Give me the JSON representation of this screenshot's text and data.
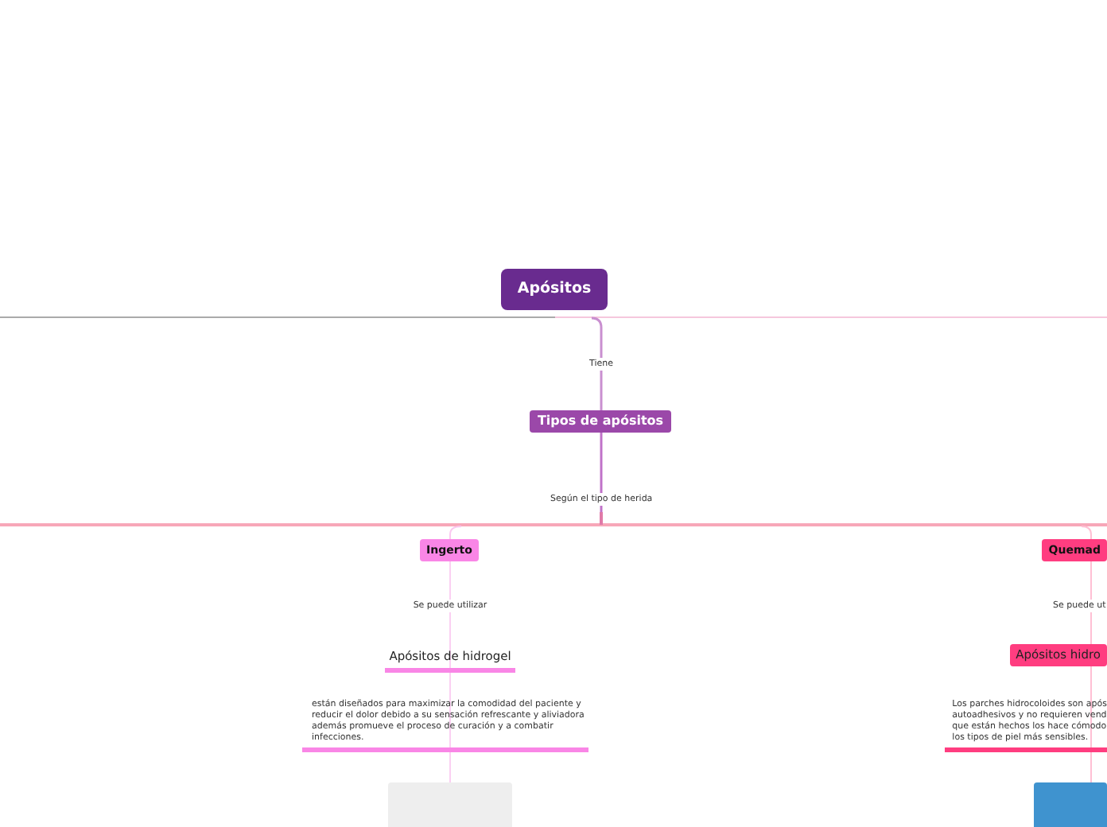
{
  "root": {
    "label": "Apósitos"
  },
  "root_link": "Tiene",
  "main_topic": {
    "label": "Tipos de apósitos"
  },
  "main_link": "Según el tipo de herida",
  "branches": [
    {
      "label": "Ingerto",
      "color": "#f986e6",
      "link": "Se puede utilizar",
      "subtopic": {
        "label": "Apósitos de hidrogel",
        "kind": "underlined"
      },
      "description": [
        "están diseñados para maximizar la comodidad del paciente y",
        "reducir el dolor  debido a su sensación refrescante y aliviadora",
        "además promueve el proceso de curación y a combatir",
        "infecciones."
      ]
    },
    {
      "label": "Quemad",
      "color": "#ff3d80",
      "link": "Se puede ut",
      "subtopic": {
        "label": "Apósitos hidro",
        "kind": "filled"
      },
      "description": [
        "Los parches hidrocoloides son após",
        "autoadhesivos y no requieren vend",
        "que están hechos los hace cómodo",
        "los tipos de piel más sensibles."
      ]
    }
  ]
}
